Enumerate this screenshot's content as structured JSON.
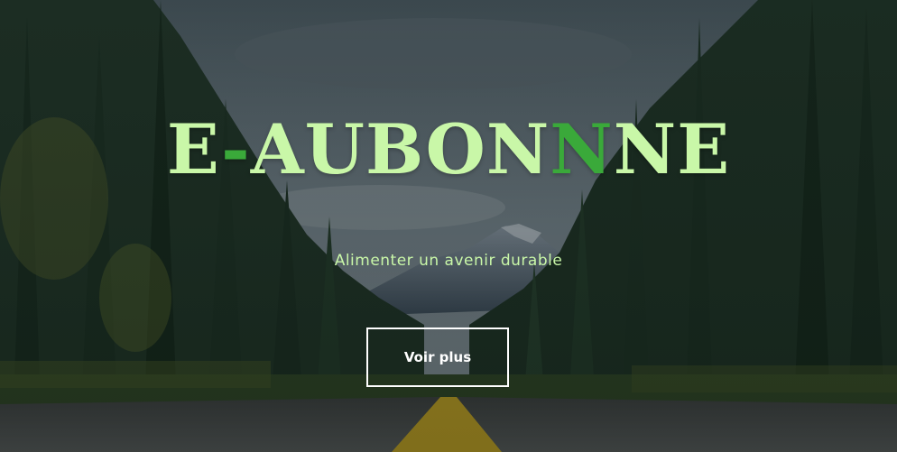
{
  "hero": {
    "title": {
      "part1": "E",
      "accent1": "-",
      "part2": "AUBON",
      "accent2": "N",
      "part3": "NE"
    },
    "subtitle": "Alimenter un avenir durable",
    "button_label": "Voir plus"
  },
  "colors": {
    "title": "#c9f7a8",
    "title_accent": "#3aa93a",
    "button_border": "#ffffff",
    "road_line": "#c8a622"
  }
}
